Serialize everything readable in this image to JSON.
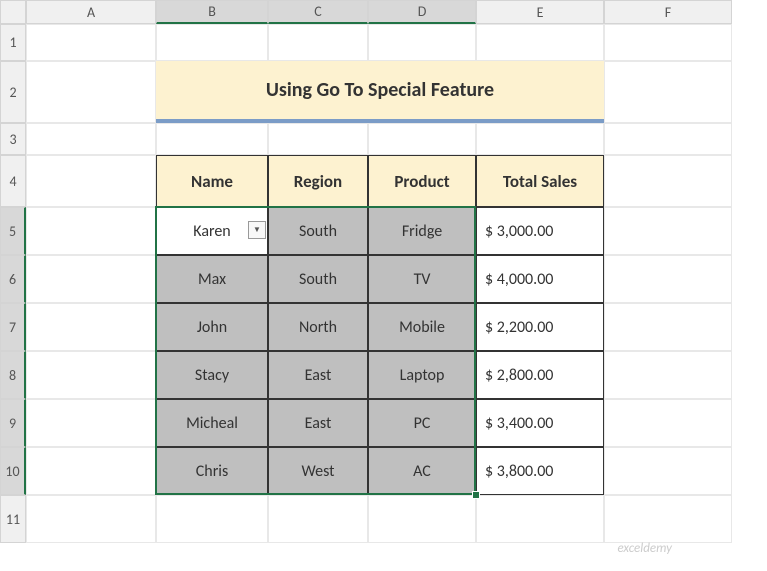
{
  "columns": [
    "A",
    "B",
    "C",
    "D",
    "E",
    "F"
  ],
  "rows": [
    "1",
    "2",
    "3",
    "4",
    "5",
    "6",
    "7",
    "8",
    "9",
    "10",
    "11"
  ],
  "title": "Using Go To Special Feature",
  "headers": {
    "name": "Name",
    "region": "Region",
    "product": "Product",
    "total_sales": "Total Sales"
  },
  "data": [
    {
      "name": "Karen",
      "region": "South",
      "product": "Fridge",
      "sales": "$  3,000.00"
    },
    {
      "name": "Max",
      "region": "South",
      "product": "TV",
      "sales": "$  4,000.00"
    },
    {
      "name": "John",
      "region": "North",
      "product": "Mobile",
      "sales": "$  2,200.00"
    },
    {
      "name": "Stacy",
      "region": "East",
      "product": "Laptop",
      "sales": "$  2,800.00"
    },
    {
      "name": "Micheal",
      "region": "East",
      "product": "PC",
      "sales": "$  3,400.00"
    },
    {
      "name": "Chris",
      "region": "West",
      "product": "AC",
      "sales": "$  3,800.00"
    }
  ],
  "watermark": "exceldemy",
  "chart_data": {
    "type": "table",
    "title": "Using Go To Special Feature",
    "columns": [
      "Name",
      "Region",
      "Product",
      "Total Sales"
    ],
    "rows": [
      [
        "Karen",
        "South",
        "Fridge",
        3000.0
      ],
      [
        "Max",
        "South",
        "TV",
        4000.0
      ],
      [
        "John",
        "North",
        "Mobile",
        2200.0
      ],
      [
        "Stacy",
        "East",
        "Laptop",
        2800.0
      ],
      [
        "Micheal",
        "East",
        "PC",
        3400.0
      ],
      [
        "Chris",
        "West",
        "AC",
        3800.0
      ]
    ]
  }
}
